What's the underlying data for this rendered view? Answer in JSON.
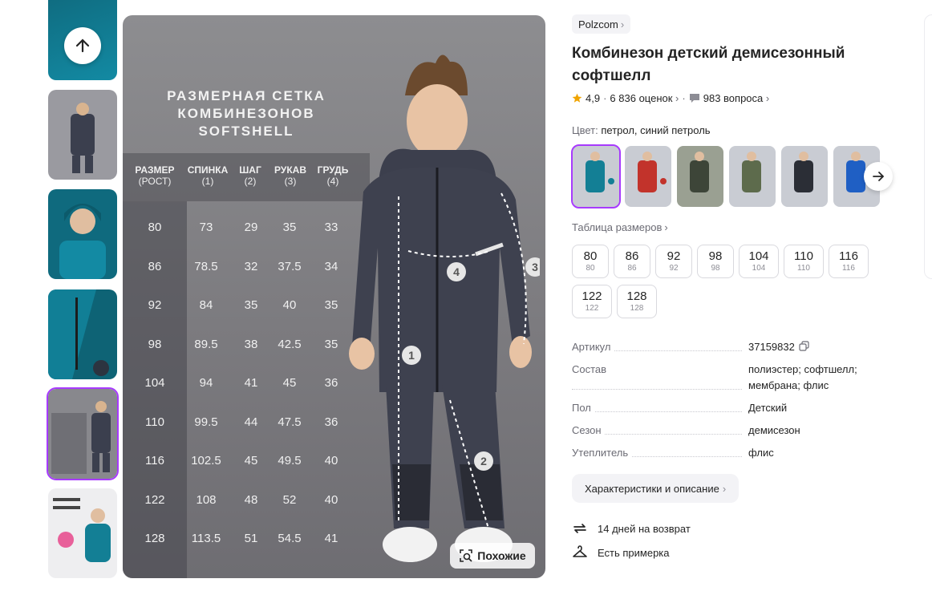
{
  "thumbnails": [
    {
      "name": "thumb-1",
      "colors": [
        "#0f6a7e",
        "#138aa3"
      ]
    },
    {
      "name": "thumb-2",
      "colors": [
        "#9a9aa0",
        "#3b3f4e"
      ]
    },
    {
      "name": "thumb-3",
      "colors": [
        "#0f6a7e",
        "#1b8aa0"
      ]
    },
    {
      "name": "thumb-4",
      "colors": [
        "#0c5f73",
        "#117f96"
      ]
    },
    {
      "name": "thumb-5",
      "colors": [
        "#8a8a8f",
        "#3b3f4e"
      ]
    },
    {
      "name": "thumb-6",
      "colors": [
        "#e9e9ec",
        "#137f95"
      ]
    }
  ],
  "main_image": {
    "title_lines": [
      "РАЗМЕРНАЯ СЕТКА",
      "КОМБИНЕЗОНОВ",
      "SOFTSHELL"
    ],
    "table_headers": [
      {
        "label": "РАЗМЕР",
        "sub": "(РОСТ)"
      },
      {
        "label": "СПИНКА",
        "sub": "(1)"
      },
      {
        "label": "ШАГ",
        "sub": "(2)"
      },
      {
        "label": "РУКАВ",
        "sub": "(3)"
      },
      {
        "label": "ГРУДЬ",
        "sub": "(4)"
      }
    ],
    "table_rows": [
      [
        "80",
        "73",
        "29",
        "35",
        "33"
      ],
      [
        "86",
        "78.5",
        "32",
        "37.5",
        "34"
      ],
      [
        "92",
        "84",
        "35",
        "40",
        "35"
      ],
      [
        "98",
        "89.5",
        "38",
        "42.5",
        "35"
      ],
      [
        "104",
        "94",
        "41",
        "45",
        "36"
      ],
      [
        "110",
        "99.5",
        "44",
        "47.5",
        "36"
      ],
      [
        "116",
        "102.5",
        "45",
        "49.5",
        "40"
      ],
      [
        "122",
        "108",
        "48",
        "52",
        "40"
      ],
      [
        "128",
        "113.5",
        "51",
        "54.5",
        "41"
      ]
    ],
    "markers": [
      "1",
      "2",
      "3",
      "4"
    ],
    "similar_label": "Похожие"
  },
  "product": {
    "brand": "Polzcom",
    "brand_chevron": "›",
    "title": "Комбинезон детский демисезонный софтшелл",
    "rating": "4,9",
    "reviews": "6 836 оценок",
    "questions": "983 вопроса",
    "color_label": "Цвет:",
    "color_value": "петрол, синий петроль",
    "swatches": [
      {
        "name": "swatch-petrol",
        "color": "#137f95"
      },
      {
        "name": "swatch-red",
        "color": "#c2332b"
      },
      {
        "name": "swatch-khaki-dark",
        "color": "#3d4538"
      },
      {
        "name": "swatch-khaki",
        "color": "#5d6b4c"
      },
      {
        "name": "swatch-black",
        "color": "#2b2e36"
      },
      {
        "name": "swatch-blue",
        "color": "#1f5fc4"
      }
    ],
    "size_table_link": "Таблица размеров",
    "sizes": [
      {
        "big": "80",
        "small": "80"
      },
      {
        "big": "86",
        "small": "86"
      },
      {
        "big": "92",
        "small": "92"
      },
      {
        "big": "98",
        "small": "98"
      },
      {
        "big": "104",
        "small": "104"
      },
      {
        "big": "110",
        "small": "110"
      },
      {
        "big": "116",
        "small": "116"
      },
      {
        "big": "122",
        "small": "122"
      },
      {
        "big": "128",
        "small": "128"
      }
    ],
    "specs": [
      {
        "key": "Артикул",
        "value": "37159832"
      },
      {
        "key": "Состав",
        "value": "полиэстер; софтшелл; мембрана; флис"
      },
      {
        "key": "Пол",
        "value": "Детский"
      },
      {
        "key": "Сезон",
        "value": "демисезон"
      },
      {
        "key": "Утеплитель",
        "value": "флис"
      }
    ],
    "description_button": "Характеристики и описание",
    "features": [
      {
        "icon": "return-arrows-icon",
        "text": "14 дней на возврат"
      },
      {
        "icon": "hanger-icon",
        "text": "Есть примерка"
      }
    ]
  },
  "colors": {
    "accent": "#a73afd",
    "star": "#f0a400",
    "muted_text": "#6b6b74",
    "chip_bg": "#f3f3f6"
  }
}
